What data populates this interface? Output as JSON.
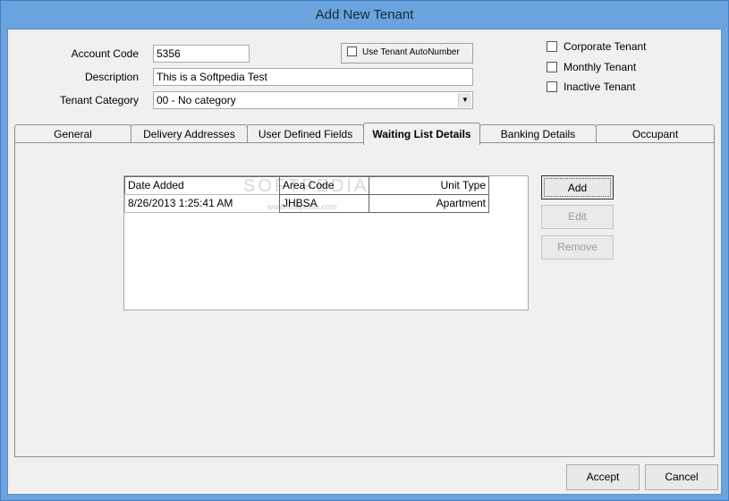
{
  "window": {
    "title": "Add New Tenant"
  },
  "form": {
    "account_code": {
      "label": "Account Code",
      "value": "5356"
    },
    "description": {
      "label": "Description",
      "value": "This is a Softpedia Test"
    },
    "tenant_category": {
      "label": "Tenant Category",
      "value": "00 - No category"
    },
    "autonumber": {
      "label": "Use Tenant AutoNumber",
      "checked": false
    }
  },
  "flags": [
    {
      "label": "Corporate Tenant",
      "checked": false
    },
    {
      "label": "Monthly Tenant",
      "checked": false
    },
    {
      "label": "Inactive Tenant",
      "checked": false
    }
  ],
  "tabs": [
    {
      "label": "General",
      "active": false
    },
    {
      "label": "Delivery Addresses",
      "active": false
    },
    {
      "label": "User Defined Fields",
      "active": false
    },
    {
      "label": "Waiting List Details",
      "active": true
    },
    {
      "label": "Banking Details",
      "active": false
    },
    {
      "label": "Occupant",
      "active": false
    }
  ],
  "waiting_list": {
    "columns": [
      "Date Added",
      "Area Code",
      "Unit Type"
    ],
    "rows": [
      [
        "8/26/2013 1:25:41 AM",
        "JHBSA",
        "Apartment"
      ]
    ],
    "buttons": {
      "add": "Add",
      "edit": "Edit",
      "remove": "Remove"
    },
    "watermark": "SOFTPEDIA",
    "watermark_url": "www.softpedia.com"
  },
  "footer": {
    "accept": "Accept",
    "cancel": "Cancel"
  },
  "colors": {
    "titlebar": "#6aa3dd",
    "client": "#f0f0f0",
    "disabled_text": "#9a9a9a"
  }
}
